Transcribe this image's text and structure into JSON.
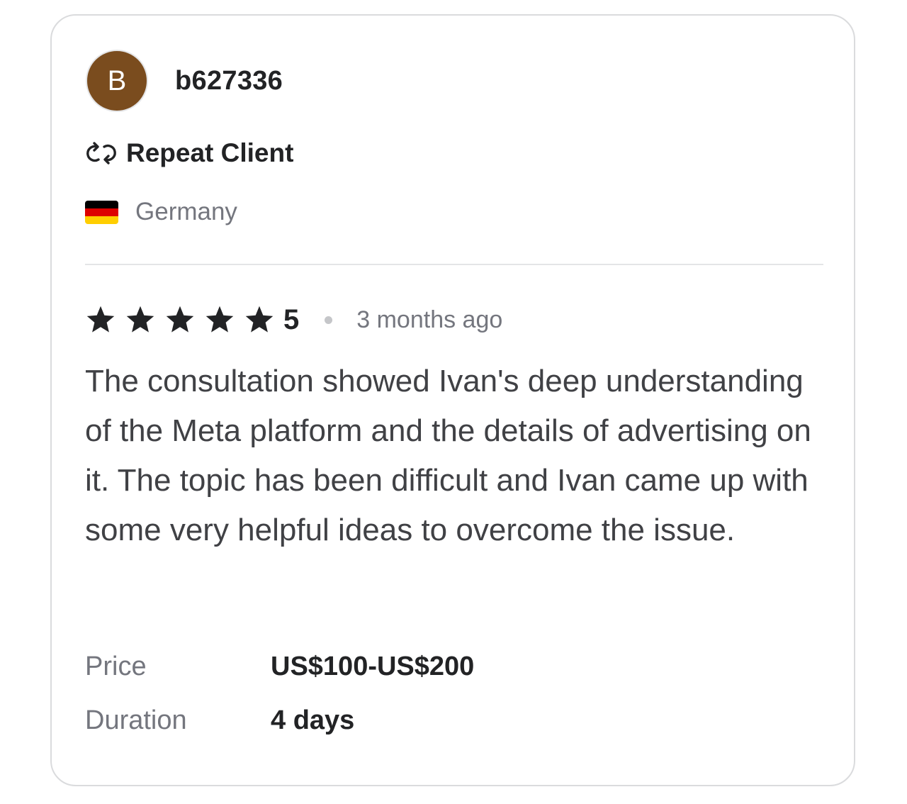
{
  "reviewer": {
    "avatar_initial": "B",
    "avatar_color": "#7a4c1e",
    "username": "b627336",
    "badge_icon": "repeat-icon",
    "badge_label": "Repeat Client",
    "country": "Germany",
    "country_flag_colors": [
      "#000000",
      "#dd0000",
      "#ffce00"
    ]
  },
  "review": {
    "star_count": 5,
    "rating": "5",
    "time_ago": "3 months ago",
    "text": "The consultation showed Ivan's deep understanding of the Meta platform and the details of advertising on it. The topic has been difficult and Ivan came up with some very helpful ideas to overcome the issue."
  },
  "details": {
    "price_label": "Price",
    "price_value": "US$100-US$200",
    "duration_label": "Duration",
    "duration_value": "4 days"
  }
}
